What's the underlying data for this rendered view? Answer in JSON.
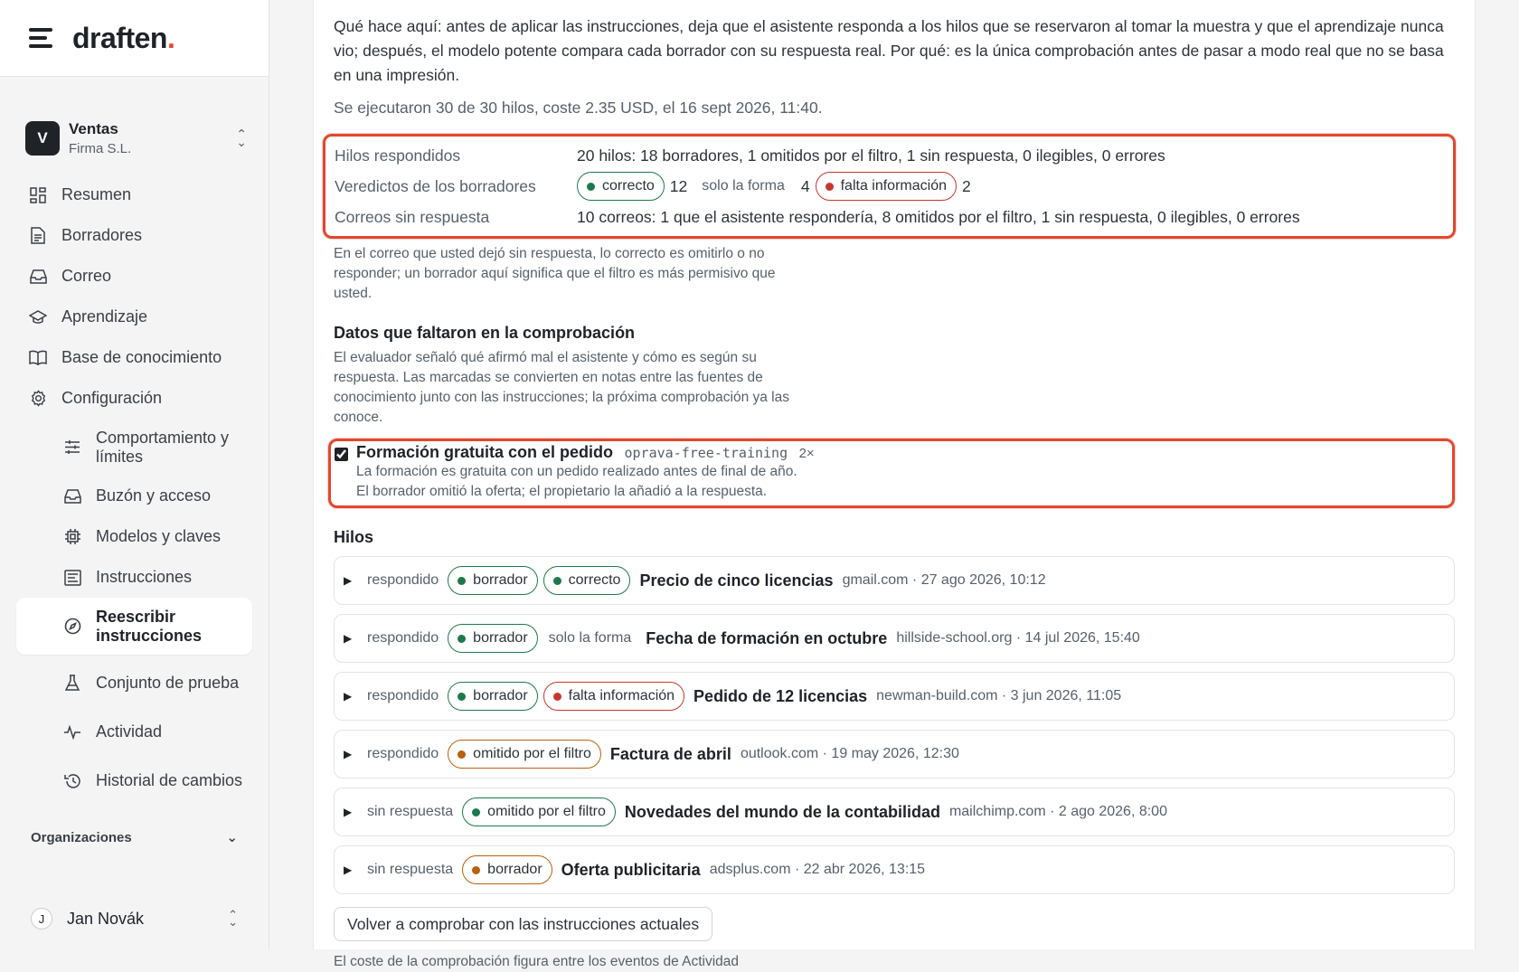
{
  "brand": {
    "name": "draften",
    "dot": "."
  },
  "org": {
    "initial": "V",
    "name": "Ventas",
    "company": "Firma S.L."
  },
  "nav": [
    {
      "label": "Resumen",
      "icon": "dashboard-icon"
    },
    {
      "label": "Borradores",
      "icon": "document-icon"
    },
    {
      "label": "Correo",
      "icon": "inbox-icon"
    },
    {
      "label": "Aprendizaje",
      "icon": "graduation-cap-icon"
    },
    {
      "label": "Base de conocimiento",
      "icon": "book-icon"
    },
    {
      "label": "Configuración",
      "icon": "gear-icon"
    }
  ],
  "subnav": [
    {
      "label": "Comportamiento y límites",
      "icon": "sliders-icon"
    },
    {
      "label": "Buzón y acceso",
      "icon": "inbox-icon"
    },
    {
      "label": "Modelos y claves",
      "icon": "chip-icon"
    },
    {
      "label": "Instrucciones",
      "icon": "instructions-icon"
    },
    {
      "label": "Reescribir instrucciones",
      "icon": "compass-icon"
    },
    {
      "label": "Conjunto de prueba",
      "icon": "flask-icon"
    },
    {
      "label": "Actividad",
      "icon": "activity-icon"
    },
    {
      "label": "Historial de cambios",
      "icon": "history-icon"
    }
  ],
  "organizations_label": "Organizaciones",
  "user": {
    "initial": "J",
    "name": "Jan Novák"
  },
  "main": {
    "intro": "Qué hace aquí: antes de aplicar las instrucciones, deja que el asistente responda a los hilos que se reservaron al tomar la muestra y que el aprendizaje nunca vio; después, el modelo potente compara cada borrador con su respuesta real. Por qué: es la única comprobación antes de pasar a modo real que no se basa en una impresión.",
    "meta": "Se ejecutaron 30 de 30 hilos, coste 2.35 USD, el 16 sept 2026, 11:40.",
    "summary": {
      "answered_label": "Hilos respondidos",
      "answered_value": "20 hilos: 18 borradores, 1 omitidos por el filtro, 1 sin respuesta, 0 ilegibles, 0 errores",
      "verdicts_label": "Veredictos de los borradores",
      "verdict_correct": "correcto",
      "verdict_correct_count": "12",
      "verdict_form": "solo la forma",
      "verdict_form_count": "4",
      "verdict_missing": "falta información",
      "verdict_missing_count": "2",
      "unanswered_label": "Correos sin respuesta",
      "unanswered_value": "10 correos: 1 que el asistente respondería, 8 omitidos por el filtro, 1 sin respuesta, 0 ilegibles, 0 errores"
    },
    "unanswered_note": "En el correo que usted dejó sin respuesta, lo correcto es omitirlo o no responder; un borrador aquí significa que el filtro es más permisivo que usted.",
    "missing_title": "Datos que faltaron en la comprobación",
    "missing_desc": "El evaluador señaló qué afirmó mal el asistente y cómo es según su respuesta. Las marcadas se convierten en notas entre las fuentes de conocimiento junto con las instrucciones; la próxima comprobación ya las conoce.",
    "gap": {
      "title": "Formación gratuita con el pedido",
      "code": "oprava-free-training",
      "count": "2×",
      "line1": "La formación es gratuita con un pedido realizado antes de final de año.",
      "line2": "El borrador omitió la oferta; el propietario la añadió a la respuesta."
    },
    "threads_title": "Hilos",
    "threads": [
      {
        "status": "respondido",
        "tag1": "borrador",
        "tag2": "correcto",
        "subject": "Precio de cinco licencias",
        "detail": "gmail.com · 27 ago 2026, 10:12"
      },
      {
        "status": "respondido",
        "tag1": "borrador",
        "tag2": "solo la forma",
        "subject": "Fecha de formación en octubre",
        "detail": "hillside-school.org · 14 jul 2026, 15:40"
      },
      {
        "status": "respondido",
        "tag1": "borrador",
        "tag2": "falta información",
        "subject": "Pedido de 12 licencias",
        "detail": "newman-build.com · 3 jun 2026, 11:05"
      },
      {
        "status": "respondido",
        "tag1": "omitido por el filtro",
        "subject": "Factura de abril",
        "detail": "outlook.com · 19 may 2026, 12:30"
      },
      {
        "status": "sin respuesta",
        "tag1": "omitido por el filtro",
        "subject": "Novedades del mundo de la contabilidad",
        "detail": "mailchimp.com · 2 ago 2026, 8:00"
      },
      {
        "status": "sin respuesta",
        "tag1": "borrador",
        "subject": "Oferta publicitaria",
        "detail": "adsplus.com · 22 abr 2026, 13:15"
      }
    ],
    "recheck_label": "Volver a comprobar con las instrucciones actuales",
    "footer": "El coste de la comprobación figura entre los eventos de Actividad"
  },
  "colors": {
    "accent": "#e0492d",
    "green": "#1c7a4a",
    "red": "#c7372f",
    "orange": "#b8610d"
  }
}
